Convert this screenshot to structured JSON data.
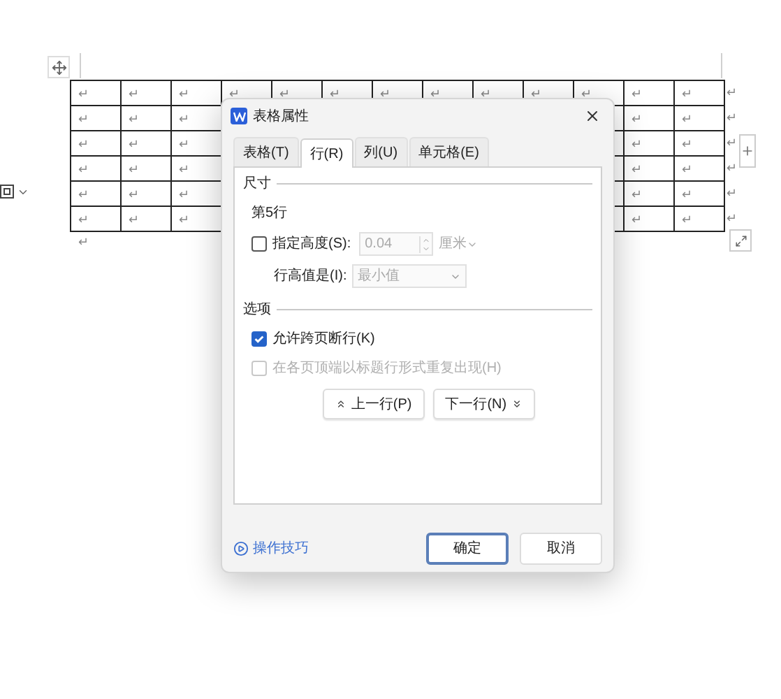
{
  "table": {
    "rows": [
      {
        "cells": [
          "↵",
          "↵",
          "↵",
          "↵",
          "↵",
          "↵",
          "↵",
          "↵",
          "↵",
          "↵",
          "↵",
          "↵",
          "↵"
        ],
        "end": "↵"
      },
      {
        "cells": [
          "↵",
          "↵",
          "↵",
          "↵",
          "↵"
        ],
        "end": "↵"
      },
      {
        "cells": [
          "↵",
          "↵",
          "↵",
          "↵",
          "↵"
        ],
        "end": "↵"
      },
      {
        "cells": [
          "↵",
          "↵",
          "↵",
          "↵",
          "↵"
        ],
        "end": "↵"
      },
      {
        "cells": [
          "↵",
          "↵",
          "↵",
          "↵",
          "↵"
        ],
        "end": "↵"
      },
      {
        "cells": [
          "↵",
          "↵",
          "↵",
          "↵",
          "↵"
        ],
        "end": "↵"
      }
    ],
    "after_mark": "↵"
  },
  "dialog": {
    "title": "表格属性",
    "tabs": [
      {
        "label": "表格(T)",
        "selected": false
      },
      {
        "label": "行(R)",
        "selected": true
      },
      {
        "label": "列(U)",
        "selected": false
      },
      {
        "label": "单元格(E)",
        "selected": false
      }
    ],
    "size_section": {
      "heading": "尺寸",
      "row_label": "第5行",
      "height": {
        "label": "指定高度(S):",
        "checked": false,
        "value": "0.04",
        "unit": "厘米"
      },
      "height_rule": {
        "label": "行高值是(I):",
        "value": "最小值"
      }
    },
    "options_section": {
      "heading": "选项",
      "options": [
        {
          "label": "允许跨页断行(K)",
          "checked": true,
          "disabled": false
        },
        {
          "label": "在各页顶端以标题行形式重复出现(H)",
          "checked": false,
          "disabled": true
        }
      ]
    },
    "nav_buttons": [
      {
        "label": "上一行(P)",
        "kind": "up"
      },
      {
        "label": "下一行(N)",
        "kind": "down"
      }
    ],
    "tips_link": "操作技巧",
    "buttons": [
      {
        "label": "确定",
        "primary": true
      },
      {
        "label": "取消",
        "primary": false
      }
    ]
  }
}
